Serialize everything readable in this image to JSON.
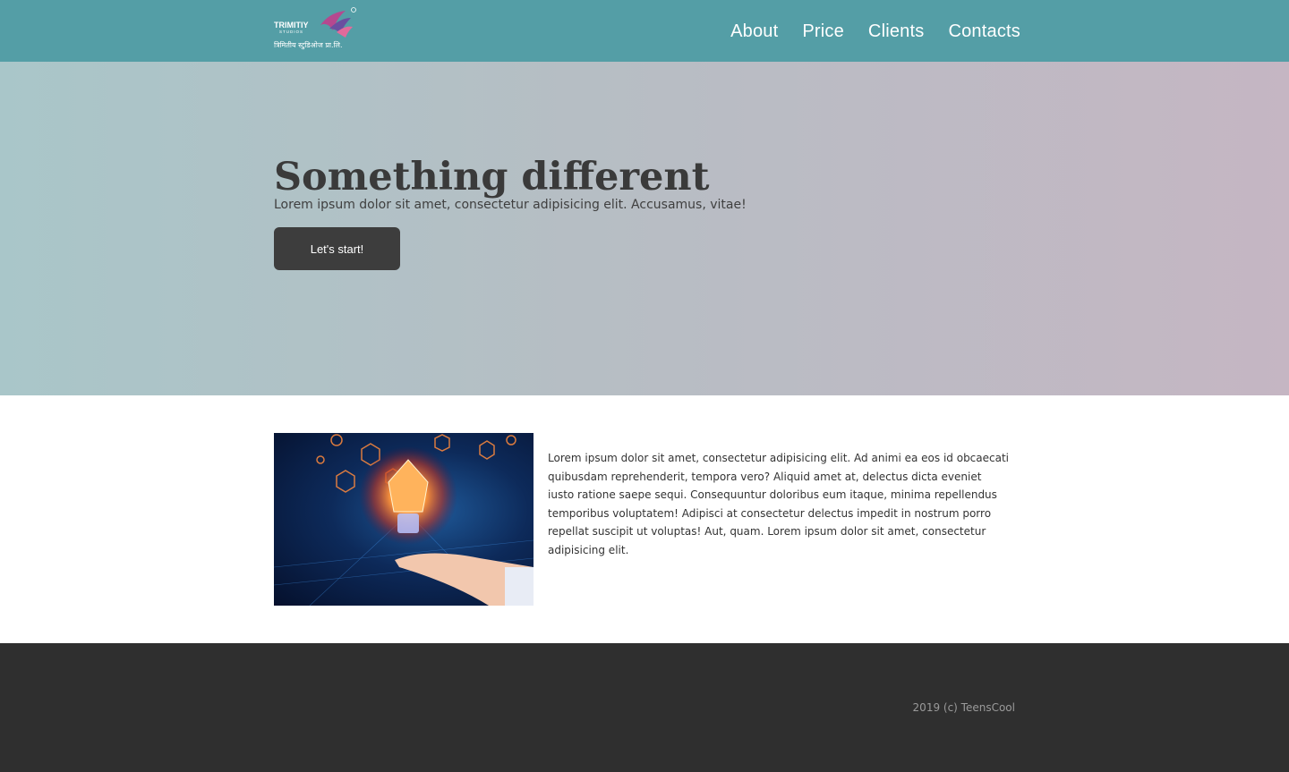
{
  "header": {
    "logo": {
      "name": "TRIMITIY",
      "tagline": "STUDIOS",
      "subtitle": "त्रिमितीय स्टुडिओज प्रा.लि.",
      "icon": "trimitiy-logo-icon"
    },
    "nav": [
      "About",
      "Price",
      "Clients",
      "Contacts"
    ]
  },
  "hero": {
    "title": "Something different",
    "subtitle": "Lorem ipsum dolor sit amet, consectetur adipisicing elit. Accusamus, vitae!",
    "button_label": "Let's start!"
  },
  "content": {
    "image_alt": "lightbulb-hand-illustration",
    "text": "Lorem ipsum dolor sit amet, consectetur adipisicing elit. Ad animi ea eos id obcaecati quibusdam reprehenderit, tempora vero? Aliquid amet at, delectus dicta eveniet iusto ratione saepe sequi. Consequuntur doloribus eum itaque, minima repellendus temporibus voluptatem! Adipisci at consectetur delectus impedit in nostrum porro repellat suscipit ut voluptas! Aut, quam. Lorem ipsum dolor sit amet, consectetur adipisicing elit."
  },
  "footer": {
    "copyright": "2019 (c) TeensCool"
  },
  "colors": {
    "header_bg": "#549ea6",
    "hero_gradient_start": "#a9c6c9",
    "hero_gradient_end": "#c5b6c3",
    "button_bg": "#3d3d3d",
    "footer_bg": "#2f2f2f"
  }
}
